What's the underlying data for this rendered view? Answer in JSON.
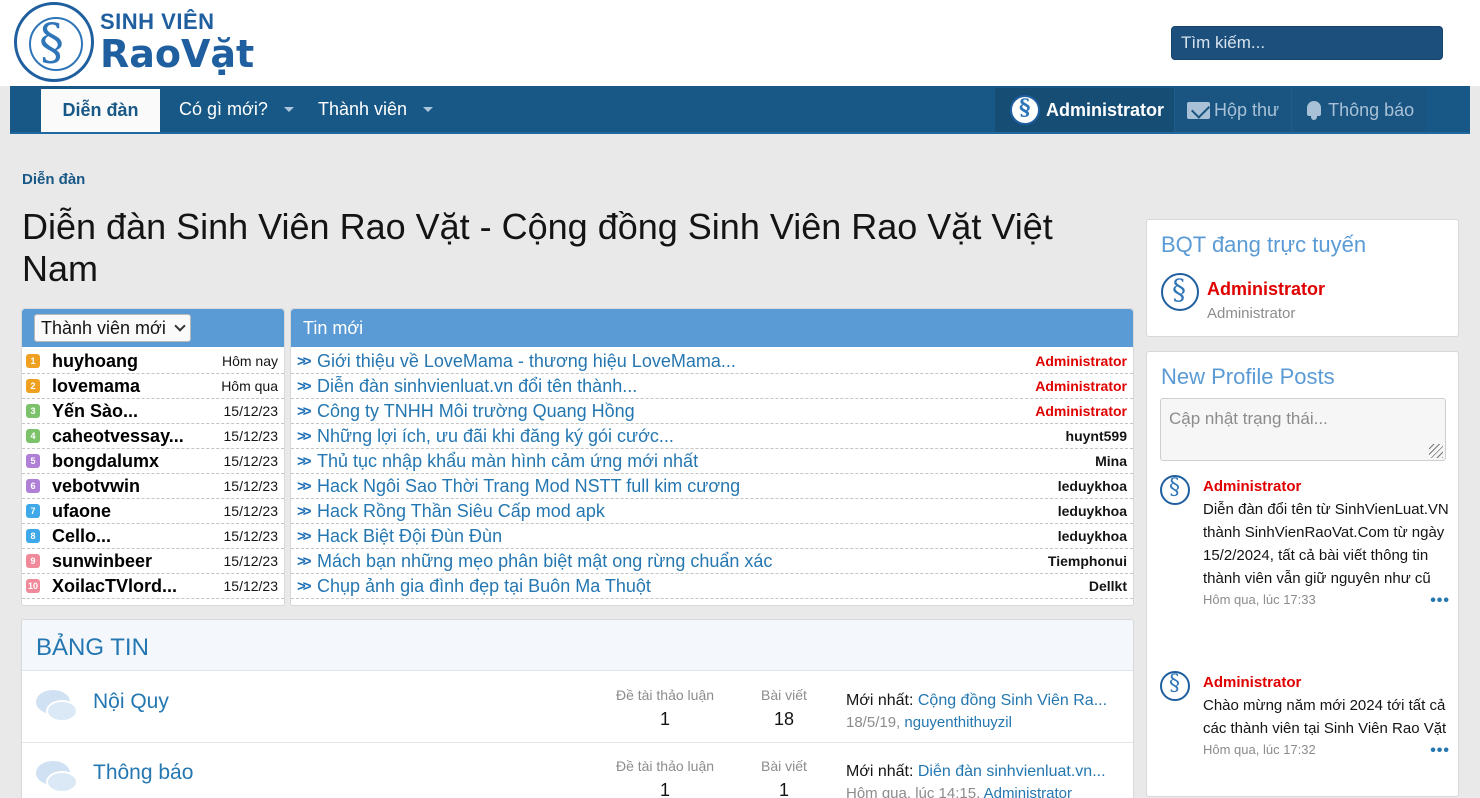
{
  "header": {
    "logo_line1": "SINH VIÊN",
    "logo_line2": "RaoVặt",
    "search_placeholder": "Tìm kiếm..."
  },
  "nav": {
    "tabs": [
      {
        "label": "Diễn đàn"
      },
      {
        "label": "Có gì mới?"
      },
      {
        "label": "Thành viên"
      }
    ],
    "user": "Administrator",
    "inbox": "Hộp thư",
    "alerts": "Thông báo"
  },
  "breadcrumb": "Diễn đàn",
  "page_title": "Diễn đàn Sinh Viên Rao Vặt - Cộng đồng Sinh Viên Rao Vặt Việt Nam",
  "new_members": {
    "select_label": "Thành viên mới",
    "rank_colors": [
      "#f0a020",
      "#f0a020",
      "#7cc26a",
      "#7cc26a",
      "#b07fd6",
      "#b07fd6",
      "#3fa8e8",
      "#3fa8e8",
      "#f08a9a",
      "#f08a9a"
    ],
    "items": [
      {
        "rank": "1",
        "name": "huyhoang",
        "date": "Hôm nay"
      },
      {
        "rank": "2",
        "name": "lovemama",
        "date": "Hôm qua"
      },
      {
        "rank": "3",
        "name": "Yến Sào...",
        "date": "15/12/23"
      },
      {
        "rank": "4",
        "name": "caheotvessay...",
        "date": "15/12/23"
      },
      {
        "rank": "5",
        "name": "bongdalumx",
        "date": "15/12/23"
      },
      {
        "rank": "6",
        "name": "vebotvwin",
        "date": "15/12/23"
      },
      {
        "rank": "7",
        "name": "ufaone",
        "date": "15/12/23"
      },
      {
        "rank": "8",
        "name": "Cello...",
        "date": "15/12/23"
      },
      {
        "rank": "9",
        "name": "sunwinbeer",
        "date": "15/12/23"
      },
      {
        "rank": "10",
        "name": "XoilacTVlord...",
        "date": "15/12/23"
      }
    ]
  },
  "new_threads": {
    "title": "Tin mới",
    "items": [
      {
        "title": "Giới thiệu về LoveMama - thương hiệu LoveMama...",
        "author": "Administrator",
        "staff": true
      },
      {
        "title": "Diễn đàn sinhvienluat.vn đổi tên thành...",
        "author": "Administrator",
        "staff": true
      },
      {
        "title": "Công ty TNHH Môi trường Quang Hồng",
        "author": "Administrator",
        "staff": true
      },
      {
        "title": "Những lợi ích, ưu đãi khi đăng ký gói cước...",
        "author": "huynt599",
        "staff": false
      },
      {
        "title": "Thủ tục nhập khẩu màn hình cảm ứng mới nhất",
        "author": "Mina",
        "staff": false
      },
      {
        "title": "Hack Ngôi Sao Thời Trang Mod NSTT full kim cương",
        "author": "leduykhoa",
        "staff": false
      },
      {
        "title": "Hack Rồng Thần Siêu Cấp mod apk",
        "author": "leduykhoa",
        "staff": false
      },
      {
        "title": "Hack Biệt Đội Đùn Đùn",
        "author": "leduykhoa",
        "staff": false
      },
      {
        "title": "Mách bạn những mẹo phân biệt mật ong rừng chuẩn xác",
        "author": "Tiemphonui",
        "staff": false
      },
      {
        "title": "Chụp ảnh gia đình đẹp tại Buôn Ma Thuột",
        "author": "Dellkt",
        "staff": false
      }
    ]
  },
  "forum": {
    "section_title": "BẢNG TIN",
    "nodes": [
      {
        "title": "Nội Quy",
        "threads_label": "Đề tài thảo luận",
        "threads": "1",
        "posts_label": "Bài viết",
        "posts": "18",
        "latest_prefix": "Mới nhất: ",
        "latest_title": "Cộng đồng Sinh Viên Ra...",
        "latest_date": "18/5/19",
        "latest_user": "nguyenthithuyzil"
      },
      {
        "title": "Thông báo",
        "threads_label": "Đề tài thảo luận",
        "threads": "1",
        "posts_label": "Bài viết",
        "posts": "1",
        "latest_prefix": "Mới nhất: ",
        "latest_title": "Diễn đàn sinhvienluat.vn...",
        "latest_date": "Hôm qua, lúc 14:15",
        "latest_user": "Administrator"
      }
    ]
  },
  "sidebar": {
    "staff_title": "BQT đang trực tuyến",
    "staff_name": "Administrator",
    "staff_role": "Administrator",
    "profile_title": "New Profile Posts",
    "status_placeholder": "Cập nhật trạng thái...",
    "posts": [
      {
        "name": "Administrator",
        "text": "Diễn đàn đổi tên từ SinhVienLuat.VN thành SinhVienRaoVat.Com từ ngày 15/2/2024, tất cả bài viết thông tin thành viên vẫn giữ nguyên như cũ",
        "time": "Hôm qua, lúc 17:33"
      },
      {
        "name": "Administrator",
        "text": "Chào mừng năm mới 2024 tới tất cả các thành viên tại Sinh Viên Rao Vặt",
        "time": "Hôm qua, lúc 17:32"
      }
    ]
  }
}
